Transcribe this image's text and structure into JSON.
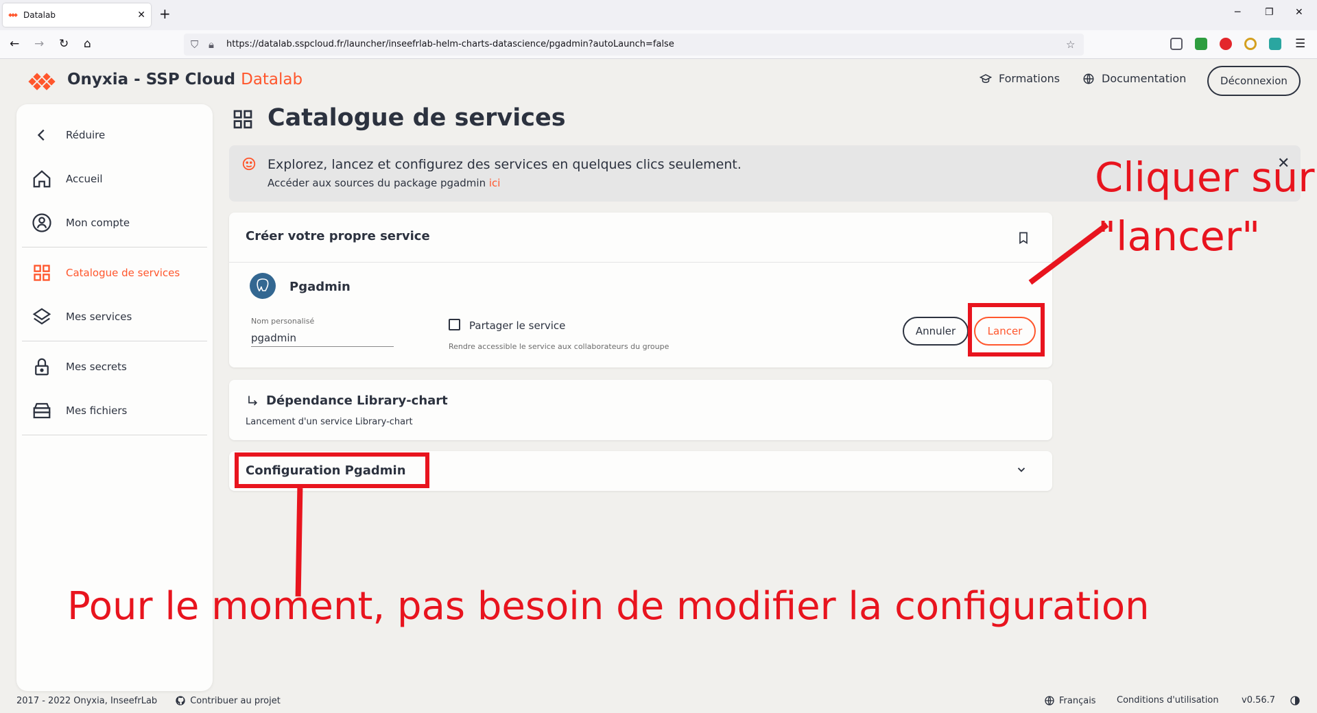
{
  "browser": {
    "tab_title": "Datalab",
    "url": "https://datalab.sspcloud.fr/launcher/inseefrlab-helm-charts-datascience/pgadmin?autoLaunch=false"
  },
  "header": {
    "brand": "Onyxia - SSP Cloud",
    "brand_accent": "Datalab",
    "formations": "Formations",
    "documentation": "Documentation",
    "logout": "Déconnexion"
  },
  "sidebar": {
    "items": [
      {
        "label": "Réduire"
      },
      {
        "label": "Accueil"
      },
      {
        "label": "Mon compte"
      },
      {
        "label": "Catalogue de services"
      },
      {
        "label": "Mes services"
      },
      {
        "label": "Mes secrets"
      },
      {
        "label": "Mes fichiers"
      }
    ]
  },
  "main": {
    "title": "Catalogue de services",
    "banner": {
      "main": "Explorez, lancez et configurez des services en quelques clics seulement.",
      "sub_prefix": "Accéder aux sources du package pgadmin",
      "sub_link": "ici"
    },
    "create_card": {
      "title": "Créer votre propre service",
      "service_name": "Pgadmin",
      "field_label": "Nom personalisé",
      "field_value": "pgadmin",
      "share_label": "Partager le service",
      "share_help": "Rendre accessible le service aux collaborateurs du groupe",
      "cancel": "Annuler",
      "launch": "Lancer"
    },
    "dependency_card": {
      "title": "Dépendance Library-chart",
      "sub": "Lancement d'un service Library-chart"
    },
    "config_card": {
      "title": "Configuration Pgadmin"
    }
  },
  "annotations": {
    "launch_line1": "Cliquer sur",
    "launch_line2": "\"lancer\"",
    "config_note": "Pour le moment, pas besoin de modifier la configuration",
    "color": "#e8141e"
  },
  "footer": {
    "copyright": "2017 - 2022 Onyxia, InseefrLab",
    "contribute": "Contribuer au projet",
    "language": "Français",
    "terms": "Conditions d'utilisation",
    "version": "v0.56.7"
  },
  "colors": {
    "accent": "#ff562c",
    "text": "#2c323f",
    "background": "#f1f0ed"
  }
}
